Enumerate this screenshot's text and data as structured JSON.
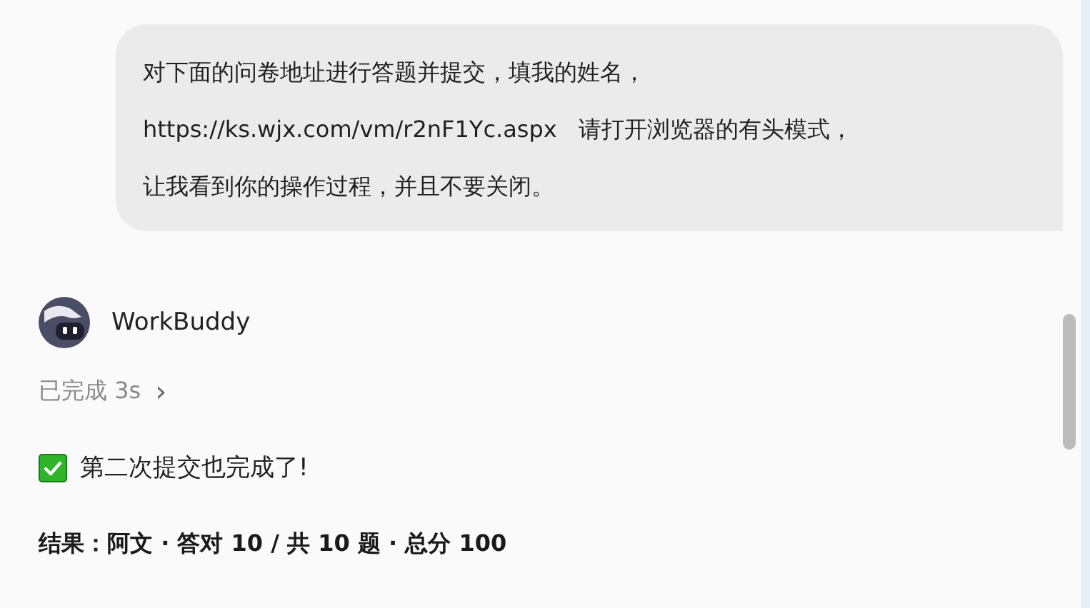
{
  "user_message": {
    "lines": [
      "对下面的问卷地址进行答题并提交，填我的姓名，",
      "https://ks.wjx.com/vm/r2nF1Yc.aspx   请打开浏览器的有头模式，",
      "让我看到你的操作过程，并且不要关闭。"
    ]
  },
  "assistant": {
    "name": "WorkBuddy",
    "status": "已完成 3s",
    "status_caret": "›"
  },
  "reply": {
    "done_line": "第二次提交也完成了!",
    "result_line": "结果：阿文 · 答对 10 / 共 10 题 · 总分 100"
  }
}
